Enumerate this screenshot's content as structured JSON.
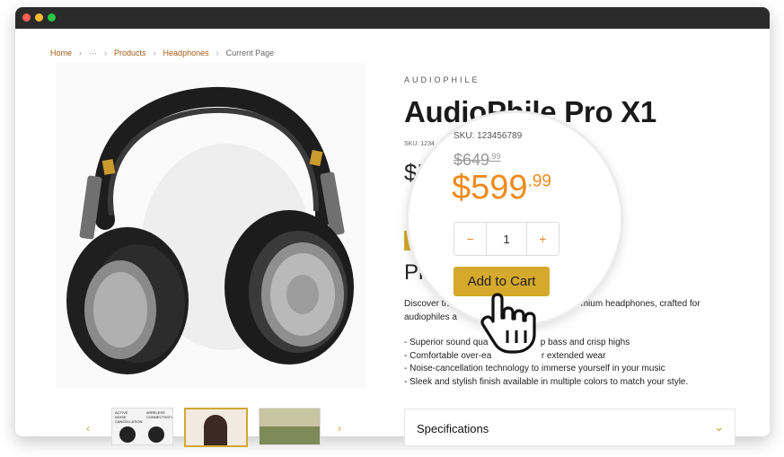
{
  "breadcrumb": {
    "items": [
      "Home",
      "···",
      "Products",
      "Headphones"
    ],
    "current": "Current Page"
  },
  "product": {
    "brand": "AUDIOPHILE",
    "title": "AudioPhile Pro X1",
    "sku_small": "SKU: 1234",
    "price_partial": "$5",
    "heading_partial": "Pr",
    "description": "Discover th                                  with our premium headphones, crafted for audiophiles a                              ke.",
    "features": [
      "- Superior sound qua                     p bass and crisp highs",
      "- Comfortable over-ea                    r extended wear",
      "- Noise-cancellation technology to immerse yourself in your music",
      "- Sleek and stylish finish available in multiple colors to match your style."
    ],
    "specifications_label": "Specifications"
  },
  "magnifier": {
    "sku": "SKU: 123456789",
    "old_price_main": "$649",
    "old_price_cents": ".99",
    "new_price_main": "$599",
    "new_price_cents": ".99",
    "quantity": "1",
    "minus": "−",
    "plus": "+",
    "add_to_cart": "Add to Cart"
  },
  "thumbnails": {
    "first_text_left": "ACTIVE NOISE CANCELLATION",
    "first_text_right": "WIRELESS CONNECTIVITY"
  },
  "colors": {
    "accent_gold": "#d4a92c",
    "price_orange": "#f08a1c",
    "link_brown": "#a15c12"
  }
}
